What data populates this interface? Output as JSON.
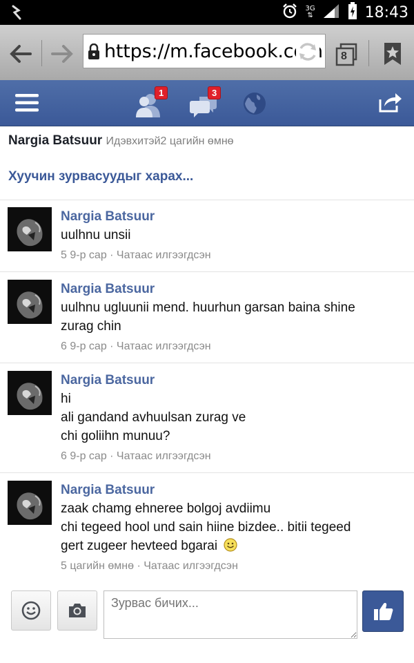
{
  "status_bar": {
    "network_label": "3G",
    "time": "18:43",
    "icons": [
      "usb-debug-icon",
      "alarm-icon",
      "signal-icon",
      "battery-charging-icon"
    ]
  },
  "browser": {
    "url": "https://m.facebook.com",
    "tab_count": "8",
    "icons": [
      "back-arrow-icon",
      "forward-arrow-icon",
      "lock-icon",
      "reload-icon",
      "tabs-icon",
      "bookmark-icon"
    ]
  },
  "fb_bar": {
    "friend_requests_count": "1",
    "messages_count": "3",
    "icons": [
      "menu-icon",
      "friend-requests-icon",
      "messages-icon",
      "globe-icon",
      "share-icon"
    ]
  },
  "thread": {
    "name": "Nargia Batsuur",
    "status": "Идэвхитэй2 цагийн өмнө",
    "older_link": "Хуучин зурвасуудыг харах..."
  },
  "messages": [
    {
      "sender": "Nargia Batsuur",
      "lines": [
        "uulhnu unsii"
      ],
      "meta": "5 9-р сар · Чатаас илгээгдсэн"
    },
    {
      "sender": "Nargia Batsuur",
      "lines": [
        "uulhnu ugluunii mend. huurhun garsan baina shine",
        "zurag chin"
      ],
      "meta": "6 9-р сар · Чатаас илгээгдсэн"
    },
    {
      "sender": "Nargia Batsuur",
      "lines": [
        "hi",
        "ali gandand avhuulsan zurag ve",
        "chi goliihn munuu?"
      ],
      "meta": "6 9-р сар · Чатаас илгээгдсэн"
    },
    {
      "sender": "Nargia Batsuur",
      "lines": [
        "zaak chamg ehneree bolgoj avdiimu",
        "chi tegeed hool und sain hiine bizdee.. bitii tegeed",
        "gert zugeer hevteed bgarai"
      ],
      "meta": "5 цагийн өмнө · Чатаас илгээгдсэн"
    }
  ],
  "composer": {
    "placeholder": "Зурвас бичих...",
    "icons": [
      "emoji-icon",
      "camera-icon",
      "like-icon"
    ]
  },
  "colors": {
    "facebook_blue": "#3b5998",
    "name_link": "#4b67a0",
    "badge_red": "#e0202a"
  }
}
